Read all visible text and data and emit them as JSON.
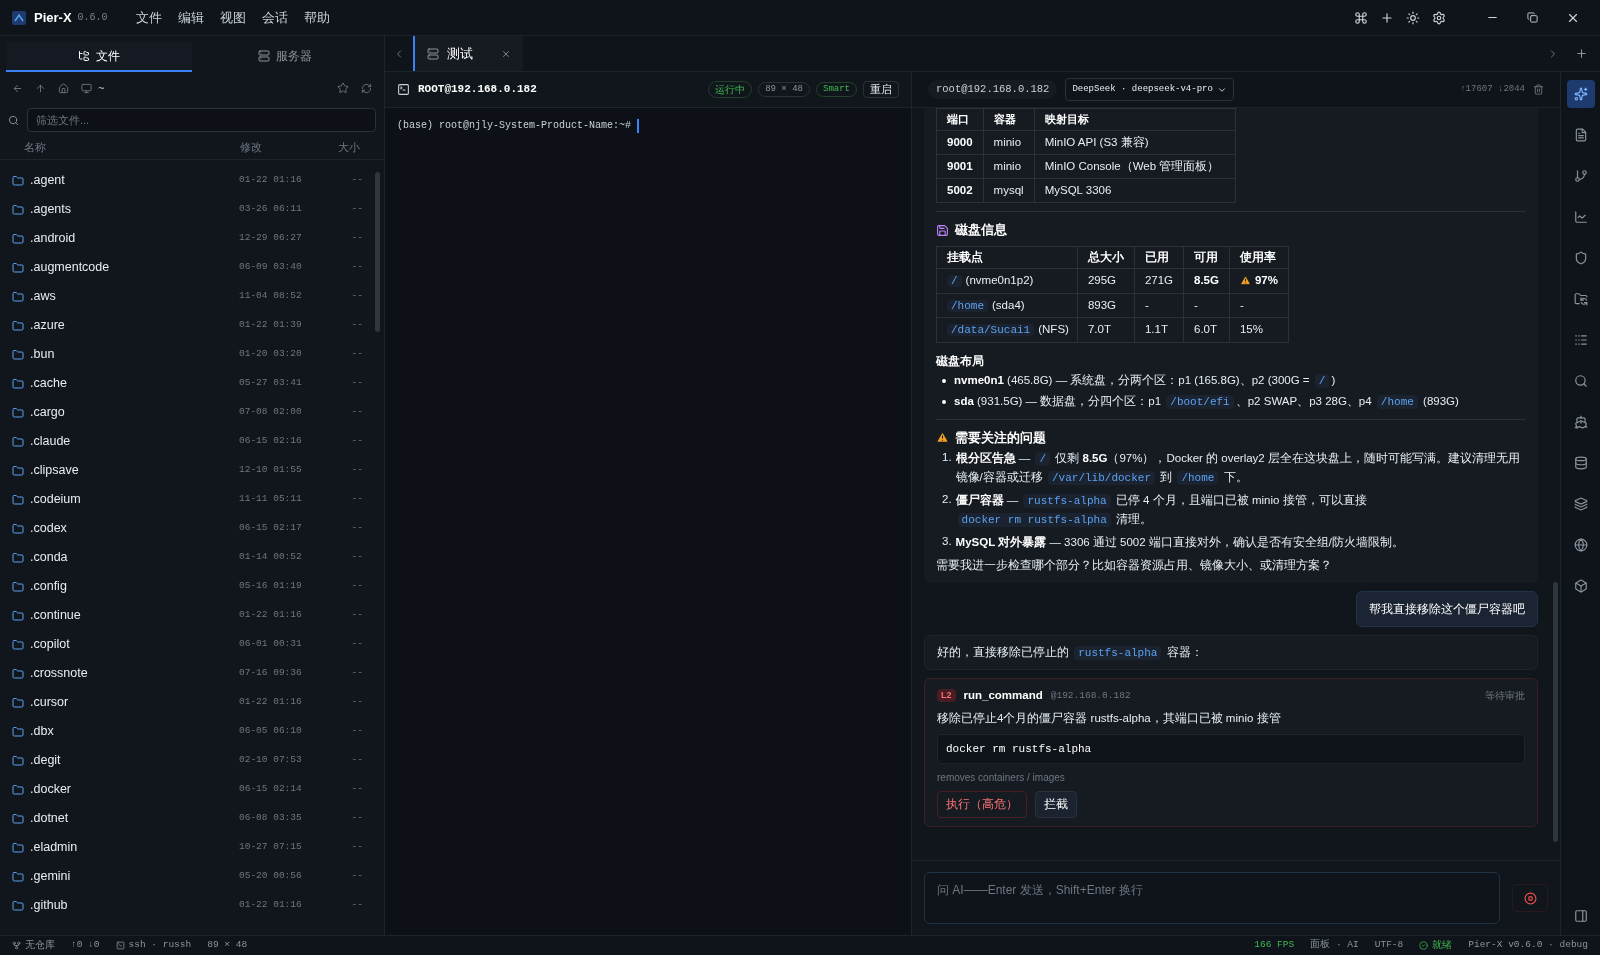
{
  "app": {
    "name": "Pier-X",
    "version": "0.6.0",
    "menu": [
      "文件",
      "编辑",
      "视图",
      "会话",
      "帮助"
    ]
  },
  "sidebar": {
    "tabs": [
      {
        "label": "文件",
        "kind": "files",
        "selected": true
      },
      {
        "label": "服务器",
        "kind": "servers",
        "selected": false
      }
    ],
    "path": "~",
    "filter": {
      "placeholder": "筛选文件..."
    },
    "columns": [
      "名称",
      "修改",
      "大小"
    ],
    "files": [
      {
        "name": ".agent",
        "modified": "01-22 01:16",
        "size": "--"
      },
      {
        "name": ".agents",
        "modified": "03-26 06:11",
        "size": "--"
      },
      {
        "name": ".android",
        "modified": "12-29 06:27",
        "size": "--"
      },
      {
        "name": ".augmentcode",
        "modified": "06-09 03:40",
        "size": "--"
      },
      {
        "name": ".aws",
        "modified": "11-04 08:52",
        "size": "--"
      },
      {
        "name": ".azure",
        "modified": "01-22 01:39",
        "size": "--"
      },
      {
        "name": ".bun",
        "modified": "01-20 03:20",
        "size": "--"
      },
      {
        "name": ".cache",
        "modified": "05-27 03:41",
        "size": "--"
      },
      {
        "name": ".cargo",
        "modified": "07-08 02:00",
        "size": "--"
      },
      {
        "name": ".claude",
        "modified": "06-15 02:16",
        "size": "--"
      },
      {
        "name": ".clipsave",
        "modified": "12-10 01:55",
        "size": "--"
      },
      {
        "name": ".codeium",
        "modified": "11-11 05:11",
        "size": "--"
      },
      {
        "name": ".codex",
        "modified": "06-15 02:17",
        "size": "--"
      },
      {
        "name": ".conda",
        "modified": "01-14 00:52",
        "size": "--"
      },
      {
        "name": ".config",
        "modified": "05-16 01:19",
        "size": "--"
      },
      {
        "name": ".continue",
        "modified": "01-22 01:16",
        "size": "--"
      },
      {
        "name": ".copilot",
        "modified": "06-01 00:31",
        "size": "--"
      },
      {
        "name": ".crossnote",
        "modified": "07-16 09:36",
        "size": "--"
      },
      {
        "name": ".cursor",
        "modified": "01-22 01:16",
        "size": "--"
      },
      {
        "name": ".dbx",
        "modified": "06-05 06:10",
        "size": "--"
      },
      {
        "name": ".degit",
        "modified": "02-10 07:53",
        "size": "--"
      },
      {
        "name": ".docker",
        "modified": "06-15 02:14",
        "size": "--"
      },
      {
        "name": ".dotnet",
        "modified": "06-08 03:35",
        "size": "--"
      },
      {
        "name": ".eladmin",
        "modified": "10-27 07:15",
        "size": "--"
      },
      {
        "name": ".gemini",
        "modified": "05-20 00:56",
        "size": "--"
      },
      {
        "name": ".github",
        "modified": "01-22 01:16",
        "size": "--"
      }
    ]
  },
  "session_tabs": [
    {
      "label": "测试",
      "selected": true
    }
  ],
  "terminal": {
    "title": "ROOT@192.168.0.182",
    "status": "运行中",
    "size": "89 × 48",
    "mode": "Smart",
    "restart": "重启",
    "line": "(base) root@njly-System-Product-Name:~#"
  },
  "chat": {
    "host": "root@192.168.0.182",
    "model": "DeepSeek · deepseek-v4-pro",
    "tokens": "↑17607 ↓2044",
    "port_table": {
      "columns": [
        "端口",
        "容器",
        "映射目标"
      ],
      "rows": [
        {
          "port": "9000",
          "container": "minio",
          "target": "MinIO API (S3 兼容)"
        },
        {
          "port": "9001",
          "container": "minio",
          "target": "MinIO Console（Web 管理面板）"
        },
        {
          "port": "5002",
          "container": "mysql",
          "target": "MySQL 3306"
        }
      ]
    },
    "disk": {
      "title": "磁盘信息",
      "columns": [
        "挂载点",
        "总大小",
        "已用",
        "可用",
        "使用率"
      ],
      "rows": [
        {
          "mount": "/",
          "device": "(nvme0n1p2)",
          "total": "295G",
          "used": "271G",
          "free": "8.5G",
          "usage": "97%",
          "alert": true
        },
        {
          "mount": "/home",
          "device": "(sda4)",
          "total": "893G",
          "used": "-",
          "free": "-",
          "usage": "-",
          "alert": false
        },
        {
          "mount": "/data/Sucai1",
          "device": "(NFS)",
          "total": "7.0T",
          "used": "1.1T",
          "free": "6.0T",
          "usage": "15%",
          "alert": false
        }
      ]
    },
    "layout": {
      "title": "磁盘布局",
      "items": [
        [
          {
            "kind": "bold",
            "text": "nvme0n1"
          },
          {
            "kind": "text",
            "text": " (465.8G) — 系统盘，分两个区：p1 (165.8G)、p2 (300G = "
          },
          {
            "kind": "code",
            "text": "/"
          },
          {
            "kind": "text",
            "text": ")"
          }
        ],
        [
          {
            "kind": "bold",
            "text": "sda"
          },
          {
            "kind": "text",
            "text": " (931.5G) — 数据盘，分四个区：p1 "
          },
          {
            "kind": "code",
            "text": "/boot/efi"
          },
          {
            "kind": "text",
            "text": "、p2 SWAP、p3 28G、p4 "
          },
          {
            "kind": "code",
            "text": "/home"
          },
          {
            "kind": "text",
            "text": " (893G)"
          }
        ]
      ]
    },
    "issues": {
      "title": "需要关注的问题",
      "items": [
        {
          "number": "1.",
          "segments": [
            {
              "kind": "bold",
              "text": "根分区告急"
            },
            {
              "kind": "text",
              "text": " — "
            },
            {
              "kind": "code",
              "text": "/"
            },
            {
              "kind": "text",
              "text": " 仅剩 "
            },
            {
              "kind": "bold",
              "text": "8.5G"
            },
            {
              "kind": "text",
              "text": "（97%），Docker 的 overlay2 层全在这块盘上，随时可能写满。建议清理无用镜像/容器或迁移 "
            },
            {
              "kind": "code",
              "text": "/var/lib/docker"
            },
            {
              "kind": "text",
              "text": " 到 "
            },
            {
              "kind": "code",
              "text": "/home"
            },
            {
              "kind": "text",
              "text": " 下。"
            }
          ]
        },
        {
          "number": "2.",
          "segments": [
            {
              "kind": "bold",
              "text": "僵尸容器"
            },
            {
              "kind": "text",
              "text": " — "
            },
            {
              "kind": "code",
              "text": "rustfs-alpha"
            },
            {
              "kind": "text",
              "text": " 已停 4 个月，且端口已被 minio 接管，可以直接 "
            },
            {
              "kind": "code",
              "text": "docker rm rustfs-alpha"
            },
            {
              "kind": "text",
              "text": " 清理。"
            }
          ]
        },
        {
          "number": "3.",
          "segments": [
            {
              "kind": "bold",
              "text": "MySQL 对外暴露"
            },
            {
              "kind": "text",
              "text": " — 3306 通过 5002 端口直接对外，确认是否有安全组/防火墙限制。"
            }
          ]
        }
      ]
    },
    "closing": "需要我进一步检查哪个部分？比如容器资源占用、镜像大小、或清理方案？",
    "user_message": "帮我直接移除这个僵尸容器吧",
    "reply": [
      {
        "kind": "text",
        "text": "好的，直接移除已停止的 "
      },
      {
        "kind": "code",
        "text": "rustfs-alpha"
      },
      {
        "kind": "text",
        "text": " 容器："
      }
    ],
    "tool": {
      "level": "L2",
      "name": "run_command",
      "host": "@192.168.0.182",
      "status": "等待审批",
      "description": "移除已停止4个月的僵尸容器 rustfs-alpha，其端口已被 minio 接管",
      "command": "docker rm rustfs-alpha",
      "note": "removes containers / images",
      "actions": [
        {
          "label": "执行（高危）",
          "kind": "danger"
        },
        {
          "label": "拦截",
          "kind": "plain"
        }
      ]
    },
    "input": {
      "placeholder": "问 AI——Enter 发送，Shift+Enter 换行"
    }
  },
  "rail": [
    {
      "kind": "sparkles",
      "selected": true
    },
    {
      "kind": "file",
      "selected": false
    },
    {
      "kind": "branch",
      "selected": false
    },
    {
      "kind": "chart",
      "selected": false
    },
    {
      "kind": "shield",
      "selected": false
    },
    {
      "kind": "folder",
      "selected": false
    },
    {
      "kind": "log",
      "selected": false
    },
    {
      "kind": "search",
      "selected": false
    },
    {
      "kind": "ship",
      "selected": false
    },
    {
      "kind": "database",
      "selected": false
    },
    {
      "kind": "layers",
      "selected": false
    },
    {
      "kind": "globe",
      "selected": false
    },
    {
      "kind": "box",
      "selected": false
    }
  ],
  "status_bar": {
    "repo": "无仓库",
    "sync": "↑0 ↓0",
    "session": "ssh · russh",
    "size": "89 × 48",
    "fps": "166 FPS",
    "panel": "面板 · AI",
    "encoding": "UTF-8",
    "state": "就绪",
    "build": "Pier-X v0.6.0 · debug"
  }
}
